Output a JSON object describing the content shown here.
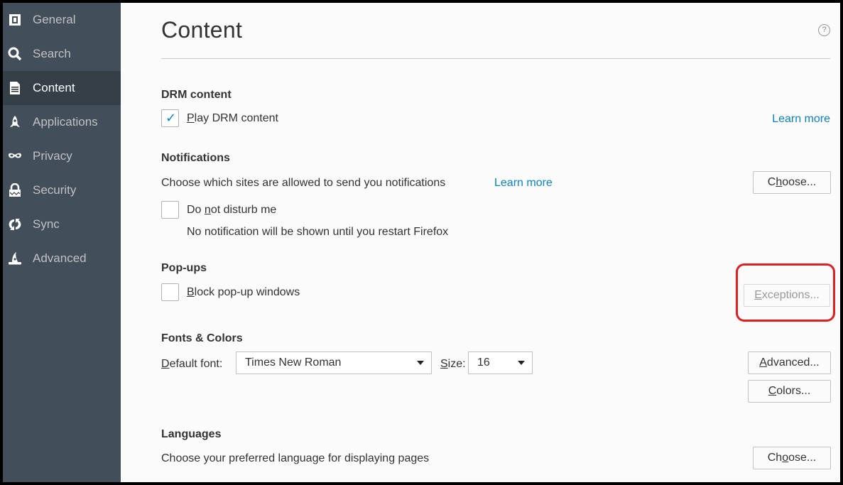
{
  "sidebar": {
    "items": [
      {
        "label": "General",
        "icon": "general-icon"
      },
      {
        "label": "Search",
        "icon": "search-icon"
      },
      {
        "label": "Content",
        "icon": "content-icon",
        "selected": true
      },
      {
        "label": "Applications",
        "icon": "applications-icon"
      },
      {
        "label": "Privacy",
        "icon": "privacy-mask-icon"
      },
      {
        "label": "Security",
        "icon": "security-lock-icon"
      },
      {
        "label": "Sync",
        "icon": "sync-icon"
      },
      {
        "label": "Advanced",
        "icon": "advanced-wizard-hat-icon"
      }
    ]
  },
  "page": {
    "title": "Content",
    "help_symbol": "?"
  },
  "drm": {
    "heading": "DRM content",
    "checkbox_label_key": "P",
    "checkbox_label_rest": "lay DRM content",
    "checked": true,
    "learn_more": "Learn more"
  },
  "notifications": {
    "heading": "Notifications",
    "description": "Choose which sites are allowed to send you notifications",
    "learn_more": "Learn more",
    "choose_button_pre": "C",
    "choose_button_key": "h",
    "choose_button_post": "oose...",
    "dnd_pre": "Do ",
    "dnd_key": "n",
    "dnd_post": "ot disturb me",
    "dnd_checked": false,
    "dnd_note": "No notification will be shown until you restart Firefox"
  },
  "popups": {
    "heading": "Pop-ups",
    "block_key": "B",
    "block_rest": "lock pop-up windows",
    "block_checked": false,
    "exceptions_key": "E",
    "exceptions_rest": "xceptions..."
  },
  "fonts": {
    "heading": "Fonts & Colors",
    "default_font_key": "D",
    "default_font_rest": "efault font:",
    "default_font_value": "Times New Roman",
    "size_key": "S",
    "size_rest": "ize:",
    "size_value": "16",
    "advanced_key": "A",
    "advanced_rest": "dvanced...",
    "colors_key": "C",
    "colors_rest": "olors..."
  },
  "languages": {
    "heading": "Languages",
    "description": "Choose your preferred language for displaying pages",
    "choose_pre": "Ch",
    "choose_key": "o",
    "choose_post": "ose..."
  },
  "colors": {
    "sidebar_bg": "#424f5a",
    "sidebar_selected": "#343f48",
    "link": "#0a84c8",
    "highlight": "#e02020"
  }
}
